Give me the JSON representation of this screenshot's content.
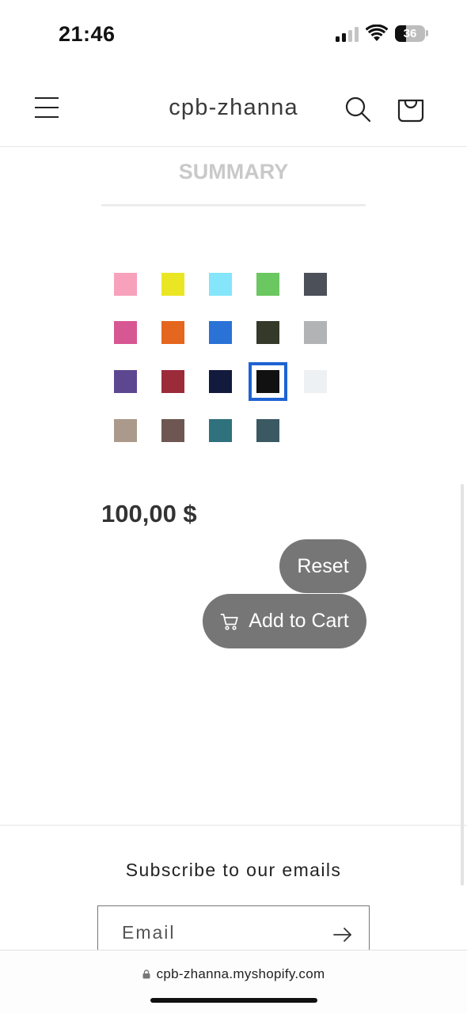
{
  "status_bar": {
    "time": "21:46",
    "battery_level": 36,
    "battery_text": "36",
    "icons": [
      "signal-icon",
      "wifi-icon",
      "battery-icon"
    ]
  },
  "header": {
    "title": "cpb-zhanna",
    "icons": [
      "menu-icon",
      "search-icon",
      "cart-icon"
    ]
  },
  "summary": {
    "heading": "SUMMARY"
  },
  "swatches": [
    {
      "color": "#f7a1bd",
      "selected": false
    },
    {
      "color": "#ebe623",
      "selected": false
    },
    {
      "color": "#84e5fb",
      "selected": false
    },
    {
      "color": "#6bc75f",
      "selected": false
    },
    {
      "color": "#4c5059",
      "selected": false
    },
    {
      "color": "#d75792",
      "selected": false
    },
    {
      "color": "#e4661f",
      "selected": false
    },
    {
      "color": "#2a72d6",
      "selected": false
    },
    {
      "color": "#34392a",
      "selected": false
    },
    {
      "color": "#b1b3b5",
      "selected": false
    },
    {
      "color": "#5d4790",
      "selected": false
    },
    {
      "color": "#9c2b3a",
      "selected": false
    },
    {
      "color": "#121a3d",
      "selected": false
    },
    {
      "color": "#111111",
      "selected": true
    },
    {
      "color": "#eef1f3",
      "selected": false
    },
    {
      "color": "#ab9a8b",
      "selected": false
    },
    {
      "color": "#6e5752",
      "selected": false
    },
    {
      "color": "#2f717c",
      "selected": false
    },
    {
      "color": "#3a5963",
      "selected": false
    }
  ],
  "product": {
    "price": "100,00 $"
  },
  "buttons": {
    "reset_label": "Reset",
    "add_to_cart_label": "Add to Cart"
  },
  "footer": {
    "subscribe_heading": "Subscribe to our emails",
    "email_placeholder": "Email"
  },
  "browser": {
    "url": "cpb-zhanna.myshopify.com"
  },
  "colors": {
    "accent": "#1f63d3",
    "button_bg": "#767676"
  }
}
